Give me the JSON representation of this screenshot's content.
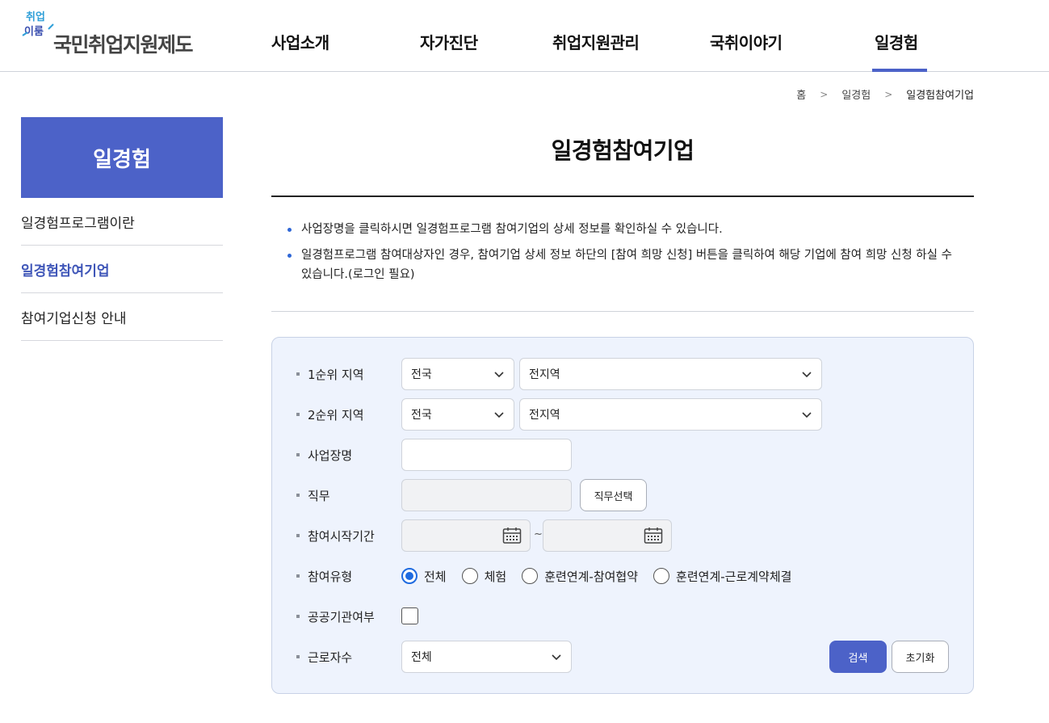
{
  "header": {
    "logo_text": "국민취업지원제도",
    "logo_mark_text": "취업 이룸",
    "nav": [
      "사업소개",
      "자가진단",
      "취업지원관리",
      "국취이야기",
      "일경험"
    ],
    "active_nav": "일경험",
    "accent_color": "#4c62c8"
  },
  "breadcrumb": {
    "home": "홈",
    "level1": "일경험",
    "current": "일경험참여기업"
  },
  "sidebar": {
    "title": "일경험",
    "items": [
      {
        "label": "일경험프로그램이란",
        "active": false
      },
      {
        "label": "일경험참여기업",
        "active": true
      },
      {
        "label": "참여기업신청 안내",
        "active": false
      }
    ]
  },
  "main": {
    "title": "일경험참여기업",
    "notes": [
      "사업장명을 클릭하시면 일경험프로그램 참여기업의 상세 정보를 확인하실 수 있습니다.",
      "일경험프로그램 참여대상자인 경우, 참여기업 상세 정보 하단의 [참여 희망 신청] 버튼을 클릭하여 해당 기업에 참여 희망 신청 하실 수 있습니다.(로그인 필요)"
    ]
  },
  "search": {
    "region1_label": "1순위 지역",
    "region1_sido": "전국",
    "region1_sigungu": "전지역",
    "region2_label": "2순위 지역",
    "region2_sido": "전국",
    "region2_sigungu": "전지역",
    "company_label": "사업장명",
    "company_value": "",
    "job_label": "직무",
    "job_value": "",
    "job_button": "직무선택",
    "period_label": "참여시작기간",
    "period_start": "",
    "period_end": "",
    "period_separator": "~",
    "type_label": "참여유형",
    "type_options": [
      "전체",
      "체험",
      "훈련연계-참여협약",
      "훈련연계-근로계약체결"
    ],
    "type_selected": "전체",
    "public_label": "공공기관여부",
    "public_checked": false,
    "workers_label": "근로자수",
    "workers_value": "전체",
    "search_button": "검색",
    "reset_button": "초기화"
  }
}
